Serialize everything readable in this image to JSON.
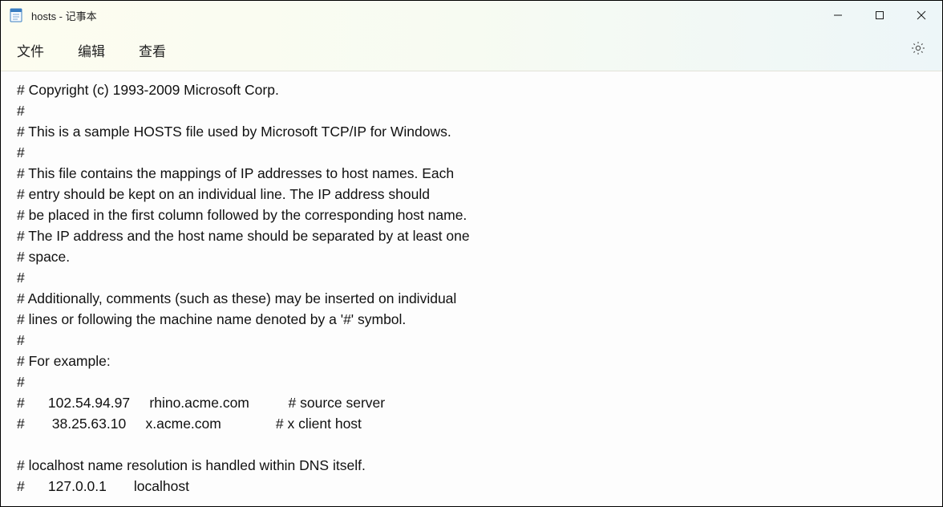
{
  "window": {
    "title": "hosts - 记事本"
  },
  "menu": {
    "file": "文件",
    "edit": "编辑",
    "view": "查看"
  },
  "content": {
    "text": "# Copyright (c) 1993-2009 Microsoft Corp.\n#\n# This is a sample HOSTS file used by Microsoft TCP/IP for Windows.\n#\n# This file contains the mappings of IP addresses to host names. Each\n# entry should be kept on an individual line. The IP address should\n# be placed in the first column followed by the corresponding host name.\n# The IP address and the host name should be separated by at least one\n# space.\n#\n# Additionally, comments (such as these) may be inserted on individual\n# lines or following the machine name denoted by a '#' symbol.\n#\n# For example:\n#\n#      102.54.94.97     rhino.acme.com          # source server\n#       38.25.63.10     x.acme.com              # x client host\n\n# localhost name resolution is handled within DNS itself.\n#\t127.0.0.1       localhost"
  }
}
